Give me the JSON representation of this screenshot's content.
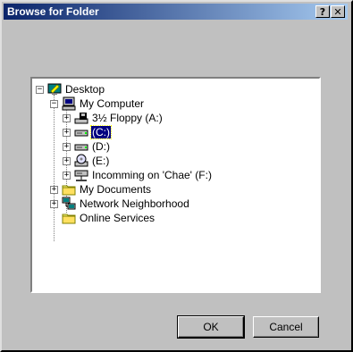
{
  "window": {
    "title": "Browse for Folder",
    "help_label": "?",
    "close_label": "✕"
  },
  "tree": {
    "items": [
      {
        "label": "Desktop",
        "icon": "desktop-icon",
        "expander": "−"
      },
      {
        "label": "My Computer",
        "icon": "computer-icon",
        "expander": "−"
      },
      {
        "label": "3½ Floppy (A:)",
        "icon": "floppy-drive-icon",
        "expander": "+"
      },
      {
        "label": "(C:)",
        "icon": "hard-drive-icon",
        "expander": "+",
        "selected": true
      },
      {
        "label": "(D:)",
        "icon": "hard-drive-icon",
        "expander": "+"
      },
      {
        "label": "(E:)",
        "icon": "cd-drive-icon",
        "expander": "+"
      },
      {
        "label": "Incomming on 'Chae' (F:)",
        "icon": "network-drive-icon",
        "expander": "+"
      },
      {
        "label": "My Documents",
        "icon": "folder-icon",
        "expander": "+"
      },
      {
        "label": "Network Neighborhood",
        "icon": "network-icon",
        "expander": "+"
      },
      {
        "label": "Online Services",
        "icon": "folder-icon",
        "expander": ""
      }
    ]
  },
  "buttons": {
    "ok_label": "OK",
    "cancel_label": "Cancel"
  },
  "colors": {
    "face": "#c0c0c0",
    "title_start": "#0a246a",
    "selection": "#000080"
  }
}
